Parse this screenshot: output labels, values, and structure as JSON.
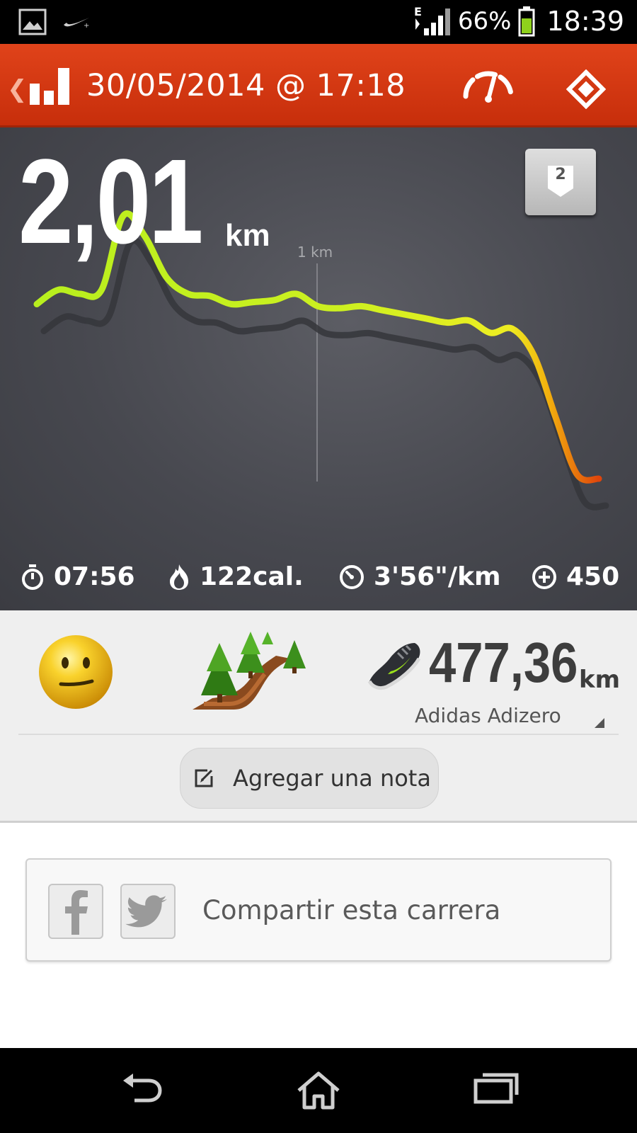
{
  "status_bar": {
    "icons": [
      "gallery-icon",
      "nike-icon",
      "edge-data-icon",
      "signal-icon",
      "battery-icon"
    ],
    "network": "E",
    "battery_percent": "66%",
    "time": "18:39"
  },
  "header": {
    "title": "30/05/2014 @ 17:18",
    "back_icon": "chevron-left-icon",
    "icons": [
      "bar-chart-icon",
      "speedometer-icon",
      "directions-icon"
    ]
  },
  "run": {
    "distance": "2,01",
    "distance_unit": "km",
    "badge_number": "2",
    "km_marker": "1 km",
    "stats": [
      {
        "icon": "stopwatch-icon",
        "value": "07:56"
      },
      {
        "icon": "flame-icon",
        "value": "122cal."
      },
      {
        "icon": "pace-gauge-icon",
        "value": "3'56\"/km"
      },
      {
        "icon": "plus-circle-icon",
        "value": "450"
      }
    ]
  },
  "details": {
    "mood_icon": "neutral-face-icon",
    "terrain_icon": "trail-icon",
    "shoe": {
      "icon": "running-shoe-icon",
      "distance": "477,36",
      "unit": "km",
      "name": "Adidas Adizero"
    },
    "note_button": "Agregar una nota"
  },
  "share": {
    "label": "Compartir esta carrera",
    "icons": [
      "facebook-icon",
      "twitter-icon"
    ]
  },
  "colors": {
    "header": "#d33a12",
    "panel": "#4a4b52",
    "line_start": "#b8ef1e",
    "line_end": "#e0450c"
  },
  "chart_data": {
    "type": "line",
    "title": "",
    "xlabel": "",
    "ylabel": "",
    "annotations": [
      "1 km"
    ],
    "series": [
      {
        "values": [
          0.45,
          0.52,
          0.5,
          0.52,
          0.88,
          0.78,
          0.58,
          0.5,
          0.49,
          0.45,
          0.46,
          0.47,
          0.5,
          0.44,
          0.43,
          0.44,
          0.42,
          0.4,
          0.38,
          0.36,
          0.37,
          0.31,
          0.33,
          0.2,
          -0.1,
          -0.38,
          -0.4
        ]
      }
    ]
  }
}
